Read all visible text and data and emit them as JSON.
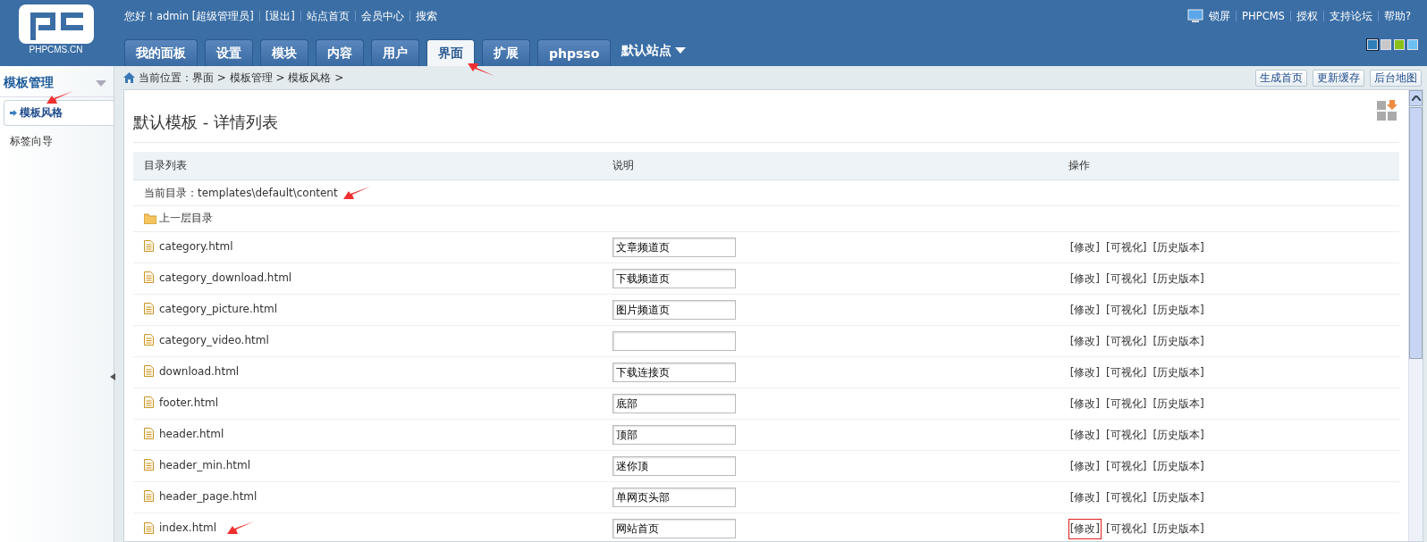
{
  "logo": {
    "text": "PHPCMS.CN"
  },
  "top_links": [
    {
      "label": "您好！admin [超级管理员]"
    },
    {
      "label": "[退出]"
    },
    {
      "label": "站点首页"
    },
    {
      "label": "会员中心"
    },
    {
      "label": "搜索"
    }
  ],
  "right_links": [
    {
      "label": "锁屏",
      "kind": "lock"
    },
    {
      "label": "PHPCMS",
      "kind": "link"
    },
    {
      "label": "授权",
      "kind": "link"
    },
    {
      "label": "支持论坛",
      "kind": "link"
    },
    {
      "label": "帮助?",
      "kind": "link"
    }
  ],
  "tabs": [
    {
      "label": "我的面板",
      "selected": false,
      "arrow": false
    },
    {
      "label": "设置",
      "selected": false,
      "arrow": false
    },
    {
      "label": "模块",
      "selected": false,
      "arrow": false
    },
    {
      "label": "内容",
      "selected": false,
      "arrow": false
    },
    {
      "label": "用户",
      "selected": false,
      "arrow": false
    },
    {
      "label": "界面",
      "selected": true,
      "arrow": true
    },
    {
      "label": "扩展",
      "selected": false,
      "arrow": false
    },
    {
      "label": "phpsso",
      "selected": false,
      "arrow": false
    }
  ],
  "site_menu": {
    "label": "默认站点"
  },
  "themes": [
    {
      "color": "#2e7fb8",
      "selected": true
    },
    {
      "color": "#c8c8c8",
      "selected": false
    },
    {
      "color": "#8cc11a",
      "selected": false
    },
    {
      "color": "#6cc0f0",
      "selected": false
    }
  ],
  "sidebar": {
    "title": "模板管理",
    "items": [
      {
        "label": "模板风格",
        "selected": true,
        "arrow": true
      },
      {
        "label": "标签向导",
        "selected": false,
        "arrow": false
      }
    ]
  },
  "breadcrumb": "当前位置：界面 > 模板管理 > 模板风格 >",
  "toolbar_buttons": [
    "生成首页",
    "更新缓存",
    "后台地图"
  ],
  "page_title": "默认模板 - 详情列表",
  "table": {
    "columns": [
      "目录列表",
      "说明",
      "操作"
    ],
    "current_dir": {
      "text": "当前目录：templates\\default\\content",
      "arrow": true
    },
    "parent_dir": "上一层目录",
    "rows": [
      {
        "file": "category.html",
        "description": "文章频道页",
        "actions": [
          "[修改]",
          "[可视化]",
          "[历史版本]"
        ],
        "highlighted": false,
        "arrow": false
      },
      {
        "file": "category_download.html",
        "description": "下载频道页",
        "actions": [
          "[修改]",
          "[可视化]",
          "[历史版本]"
        ],
        "highlighted": false,
        "arrow": false
      },
      {
        "file": "category_picture.html",
        "description": "图片频道页",
        "actions": [
          "[修改]",
          "[可视化]",
          "[历史版本]"
        ],
        "highlighted": false,
        "arrow": false
      },
      {
        "file": "category_video.html",
        "actions": [
          "[修改]",
          "[可视化]",
          "[历史版本]"
        ],
        "highlighted": false,
        "arrow": false
      },
      {
        "file": "download.html",
        "description": "下载连接页",
        "actions": [
          "[修改]",
          "[可视化]",
          "[历史版本]"
        ],
        "highlighted": false,
        "arrow": false
      },
      {
        "file": "footer.html",
        "description": "底部",
        "actions": [
          "[修改]",
          "[可视化]",
          "[历史版本]"
        ],
        "highlighted": false,
        "arrow": false
      },
      {
        "file": "header.html",
        "description": "顶部",
        "actions": [
          "[修改]",
          "[可视化]",
          "[历史版本]"
        ],
        "highlighted": false,
        "arrow": false
      },
      {
        "file": "header_min.html",
        "description": "迷你顶",
        "actions": [
          "[修改]",
          "[可视化]",
          "[历史版本]"
        ],
        "highlighted": false,
        "arrow": false
      },
      {
        "file": "header_page.html",
        "description": "单网页头部",
        "actions": [
          "[修改]",
          "[可视化]",
          "[历史版本]"
        ],
        "highlighted": false,
        "arrow": false
      },
      {
        "file": "index.html",
        "description": "网站首页",
        "actions": [
          "[修改]",
          "[可视化]",
          "[历史版本]"
        ],
        "highlighted": true,
        "arrow": true
      }
    ]
  }
}
